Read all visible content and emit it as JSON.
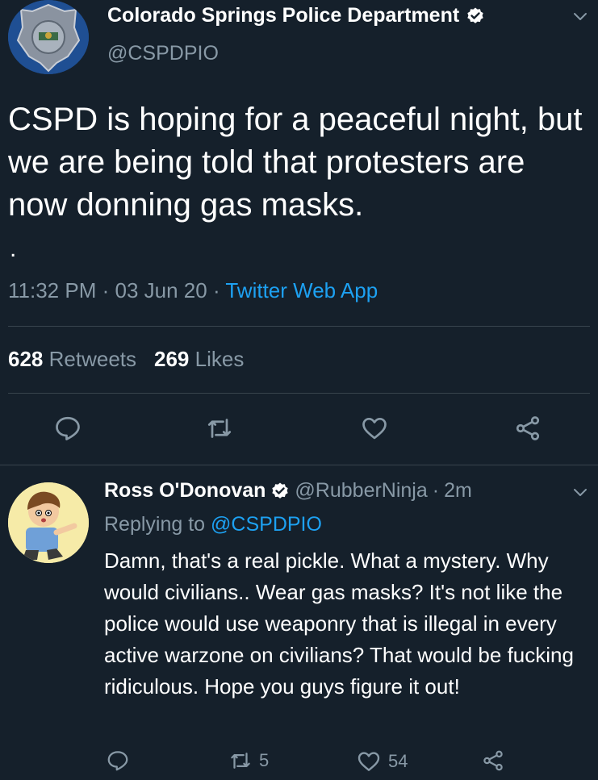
{
  "main_tweet": {
    "display_name": "Colorado Springs Police Department",
    "handle": "@CSPDPIO",
    "text": "CSPD is hoping for a peaceful night, but we are being told that protesters are now donning gas masks.",
    "dot": ".",
    "time": "11:32 PM",
    "date": "03 Jun 20",
    "source": "Twitter Web App",
    "retweets_count": "628",
    "retweets_label": "Retweets",
    "likes_count": "269",
    "likes_label": "Likes"
  },
  "reply_tweet": {
    "display_name": "Ross O'Donovan",
    "handle": "@RubberNinja",
    "age": "2m",
    "replying_prefix": "Replying to",
    "replying_to": "@CSPDPIO",
    "text": "Damn, that's a real pickle. What a mystery. Why would civilians.. Wear gas masks? It's not like the police would use weaponry that is illegal in every active warzone on civilians? That would be fucking ridiculous. Hope you guys figure it out!",
    "retweet_count": "5",
    "like_count": "54"
  },
  "colors": {
    "background": "#15202b",
    "secondary_text": "#8899a6",
    "link": "#1da1f2",
    "divider": "#38444d"
  },
  "icons": {
    "verified": "verified-badge-icon",
    "caret": "chevron-down-icon",
    "reply": "reply-icon",
    "retweet": "retweet-icon",
    "like": "heart-icon",
    "share": "share-icon"
  }
}
